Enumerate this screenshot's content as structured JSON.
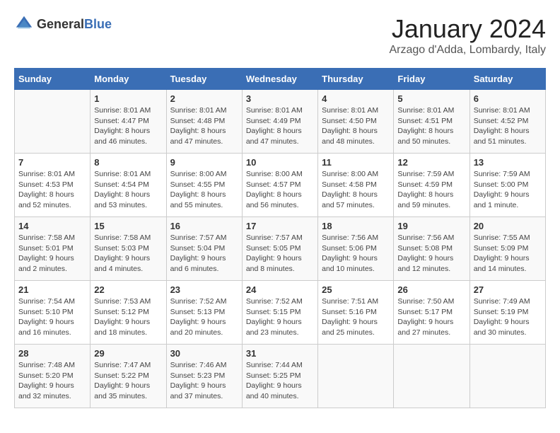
{
  "header": {
    "logo_general": "General",
    "logo_blue": "Blue",
    "title": "January 2024",
    "subtitle": "Arzago d'Adda, Lombardy, Italy"
  },
  "columns": [
    "Sunday",
    "Monday",
    "Tuesday",
    "Wednesday",
    "Thursday",
    "Friday",
    "Saturday"
  ],
  "weeks": [
    [
      {
        "day": "",
        "content": ""
      },
      {
        "day": "1",
        "content": "Sunrise: 8:01 AM\nSunset: 4:47 PM\nDaylight: 8 hours\nand 46 minutes."
      },
      {
        "day": "2",
        "content": "Sunrise: 8:01 AM\nSunset: 4:48 PM\nDaylight: 8 hours\nand 47 minutes."
      },
      {
        "day": "3",
        "content": "Sunrise: 8:01 AM\nSunset: 4:49 PM\nDaylight: 8 hours\nand 47 minutes."
      },
      {
        "day": "4",
        "content": "Sunrise: 8:01 AM\nSunset: 4:50 PM\nDaylight: 8 hours\nand 48 minutes."
      },
      {
        "day": "5",
        "content": "Sunrise: 8:01 AM\nSunset: 4:51 PM\nDaylight: 8 hours\nand 50 minutes."
      },
      {
        "day": "6",
        "content": "Sunrise: 8:01 AM\nSunset: 4:52 PM\nDaylight: 8 hours\nand 51 minutes."
      }
    ],
    [
      {
        "day": "7",
        "content": "Sunrise: 8:01 AM\nSunset: 4:53 PM\nDaylight: 8 hours\nand 52 minutes."
      },
      {
        "day": "8",
        "content": "Sunrise: 8:01 AM\nSunset: 4:54 PM\nDaylight: 8 hours\nand 53 minutes."
      },
      {
        "day": "9",
        "content": "Sunrise: 8:00 AM\nSunset: 4:55 PM\nDaylight: 8 hours\nand 55 minutes."
      },
      {
        "day": "10",
        "content": "Sunrise: 8:00 AM\nSunset: 4:57 PM\nDaylight: 8 hours\nand 56 minutes."
      },
      {
        "day": "11",
        "content": "Sunrise: 8:00 AM\nSunset: 4:58 PM\nDaylight: 8 hours\nand 57 minutes."
      },
      {
        "day": "12",
        "content": "Sunrise: 7:59 AM\nSunset: 4:59 PM\nDaylight: 8 hours\nand 59 minutes."
      },
      {
        "day": "13",
        "content": "Sunrise: 7:59 AM\nSunset: 5:00 PM\nDaylight: 9 hours\nand 1 minute."
      }
    ],
    [
      {
        "day": "14",
        "content": "Sunrise: 7:58 AM\nSunset: 5:01 PM\nDaylight: 9 hours\nand 2 minutes."
      },
      {
        "day": "15",
        "content": "Sunrise: 7:58 AM\nSunset: 5:03 PM\nDaylight: 9 hours\nand 4 minutes."
      },
      {
        "day": "16",
        "content": "Sunrise: 7:57 AM\nSunset: 5:04 PM\nDaylight: 9 hours\nand 6 minutes."
      },
      {
        "day": "17",
        "content": "Sunrise: 7:57 AM\nSunset: 5:05 PM\nDaylight: 9 hours\nand 8 minutes."
      },
      {
        "day": "18",
        "content": "Sunrise: 7:56 AM\nSunset: 5:06 PM\nDaylight: 9 hours\nand 10 minutes."
      },
      {
        "day": "19",
        "content": "Sunrise: 7:56 AM\nSunset: 5:08 PM\nDaylight: 9 hours\nand 12 minutes."
      },
      {
        "day": "20",
        "content": "Sunrise: 7:55 AM\nSunset: 5:09 PM\nDaylight: 9 hours\nand 14 minutes."
      }
    ],
    [
      {
        "day": "21",
        "content": "Sunrise: 7:54 AM\nSunset: 5:10 PM\nDaylight: 9 hours\nand 16 minutes."
      },
      {
        "day": "22",
        "content": "Sunrise: 7:53 AM\nSunset: 5:12 PM\nDaylight: 9 hours\nand 18 minutes."
      },
      {
        "day": "23",
        "content": "Sunrise: 7:52 AM\nSunset: 5:13 PM\nDaylight: 9 hours\nand 20 minutes."
      },
      {
        "day": "24",
        "content": "Sunrise: 7:52 AM\nSunset: 5:15 PM\nDaylight: 9 hours\nand 23 minutes."
      },
      {
        "day": "25",
        "content": "Sunrise: 7:51 AM\nSunset: 5:16 PM\nDaylight: 9 hours\nand 25 minutes."
      },
      {
        "day": "26",
        "content": "Sunrise: 7:50 AM\nSunset: 5:17 PM\nDaylight: 9 hours\nand 27 minutes."
      },
      {
        "day": "27",
        "content": "Sunrise: 7:49 AM\nSunset: 5:19 PM\nDaylight: 9 hours\nand 30 minutes."
      }
    ],
    [
      {
        "day": "28",
        "content": "Sunrise: 7:48 AM\nSunset: 5:20 PM\nDaylight: 9 hours\nand 32 minutes."
      },
      {
        "day": "29",
        "content": "Sunrise: 7:47 AM\nSunset: 5:22 PM\nDaylight: 9 hours\nand 35 minutes."
      },
      {
        "day": "30",
        "content": "Sunrise: 7:46 AM\nSunset: 5:23 PM\nDaylight: 9 hours\nand 37 minutes."
      },
      {
        "day": "31",
        "content": "Sunrise: 7:44 AM\nSunset: 5:25 PM\nDaylight: 9 hours\nand 40 minutes."
      },
      {
        "day": "",
        "content": ""
      },
      {
        "day": "",
        "content": ""
      },
      {
        "day": "",
        "content": ""
      }
    ]
  ]
}
